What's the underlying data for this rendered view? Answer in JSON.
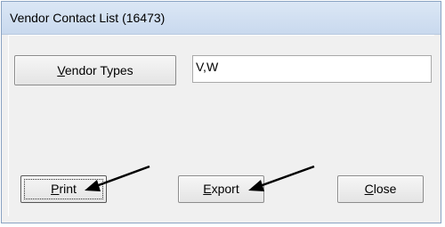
{
  "window": {
    "title": "Vendor Contact List (16473)"
  },
  "vendor_types": {
    "button_label_mnemonic": "V",
    "button_label_rest": "endor Types",
    "value": "V,W"
  },
  "buttons": {
    "print_mnemonic": "P",
    "print_rest": "rint",
    "export_mnemonic": "E",
    "export_rest": "xport",
    "close_mnemonic": "C",
    "close_rest": "lose"
  },
  "annotations": {
    "arrow_color": "#000000"
  }
}
